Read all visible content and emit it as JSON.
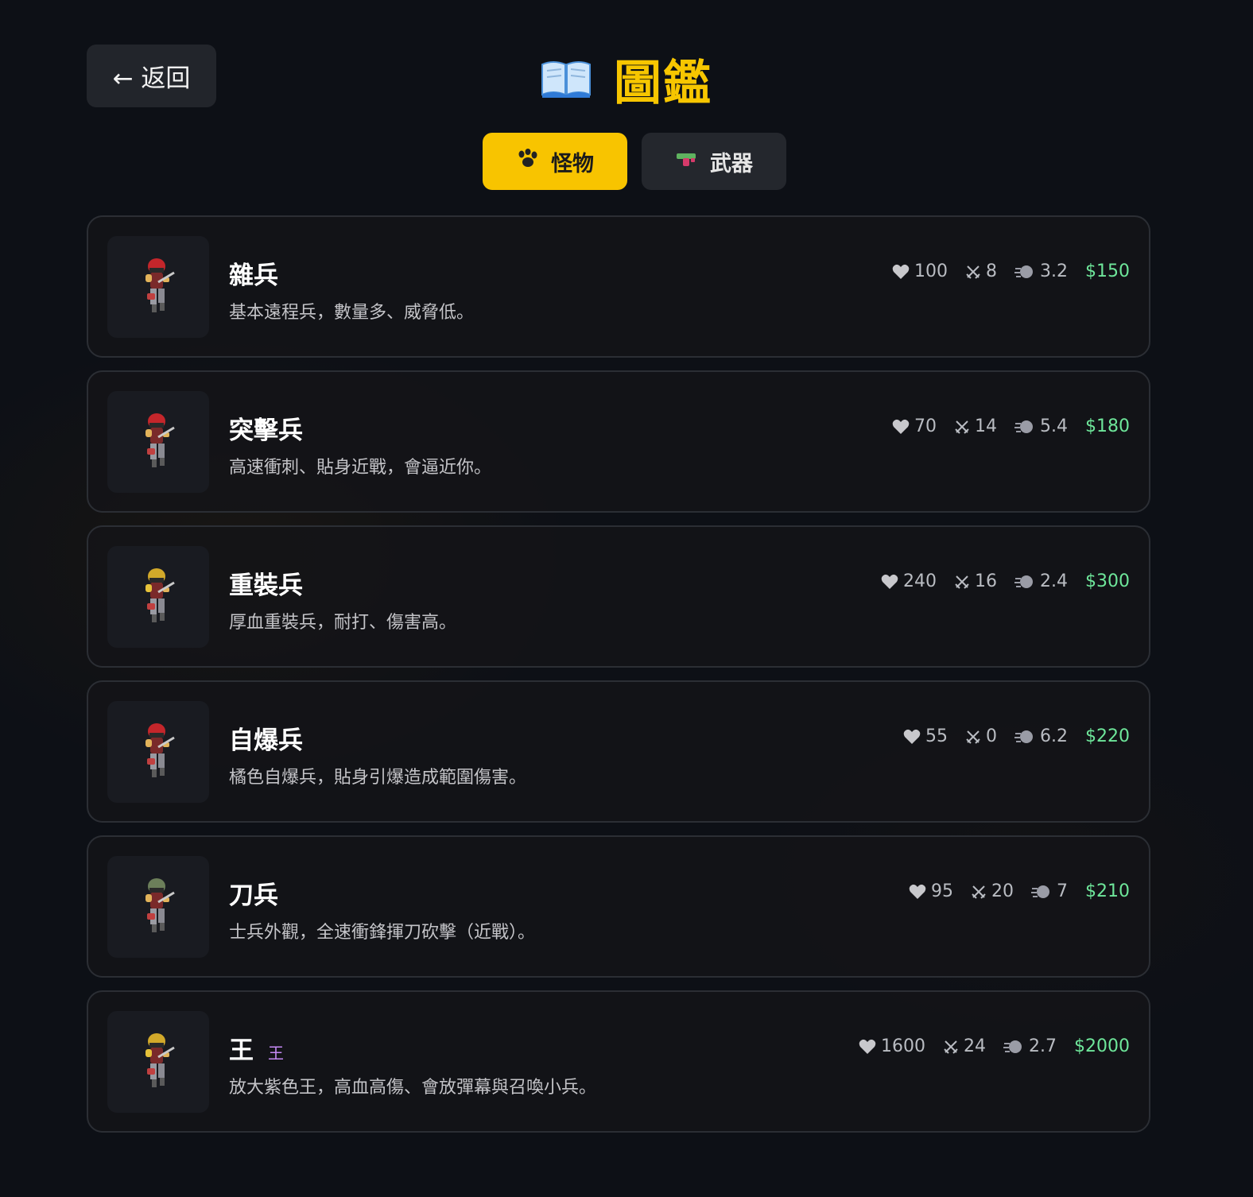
{
  "header": {
    "back_label": "← 返回",
    "title": "圖鑑",
    "title_icon": "open-book-icon"
  },
  "tabs": [
    {
      "label": "怪物",
      "icon": "paw-icon",
      "active": true
    },
    {
      "label": "武器",
      "icon": "water-gun-icon",
      "active": false
    }
  ],
  "monsters": [
    {
      "name": "雜兵",
      "desc": "基本遠程兵，數量多、威脅低。",
      "hp": "100",
      "atk": "8",
      "spd": "3.2",
      "price": "$150",
      "helmet": "#c4262b",
      "tag": ""
    },
    {
      "name": "突擊兵",
      "desc": "高速衝刺、貼身近戰，會逼近你。",
      "hp": "70",
      "atk": "14",
      "spd": "5.4",
      "price": "$180",
      "helmet": "#c4262b",
      "tag": ""
    },
    {
      "name": "重裝兵",
      "desc": "厚血重裝兵，耐打、傷害高。",
      "hp": "240",
      "atk": "16",
      "spd": "2.4",
      "price": "$300",
      "helmet": "#d2a92a",
      "tag": ""
    },
    {
      "name": "自爆兵",
      "desc": "橘色自爆兵，貼身引爆造成範圍傷害。",
      "hp": "55",
      "atk": "0",
      "spd": "6.2",
      "price": "$220",
      "helmet": "#c4262b",
      "tag": ""
    },
    {
      "name": "刀兵",
      "desc": "士兵外觀，全速衝鋒揮刀砍擊（近戰）。",
      "hp": "95",
      "atk": "20",
      "spd": "7",
      "price": "$210",
      "helmet": "#6c7f5a",
      "tag": ""
    },
    {
      "name": "王",
      "desc": "放大紫色王，高血高傷、會放彈幕與召喚小兵。",
      "hp": "1600",
      "atk": "24",
      "spd": "2.7",
      "price": "$2000",
      "helmet": "#d2a92a",
      "tag": "王"
    }
  ],
  "colors": {
    "accent": "#f8c400",
    "price": "#6ee69a",
    "boss_tag": "#c58af5"
  }
}
